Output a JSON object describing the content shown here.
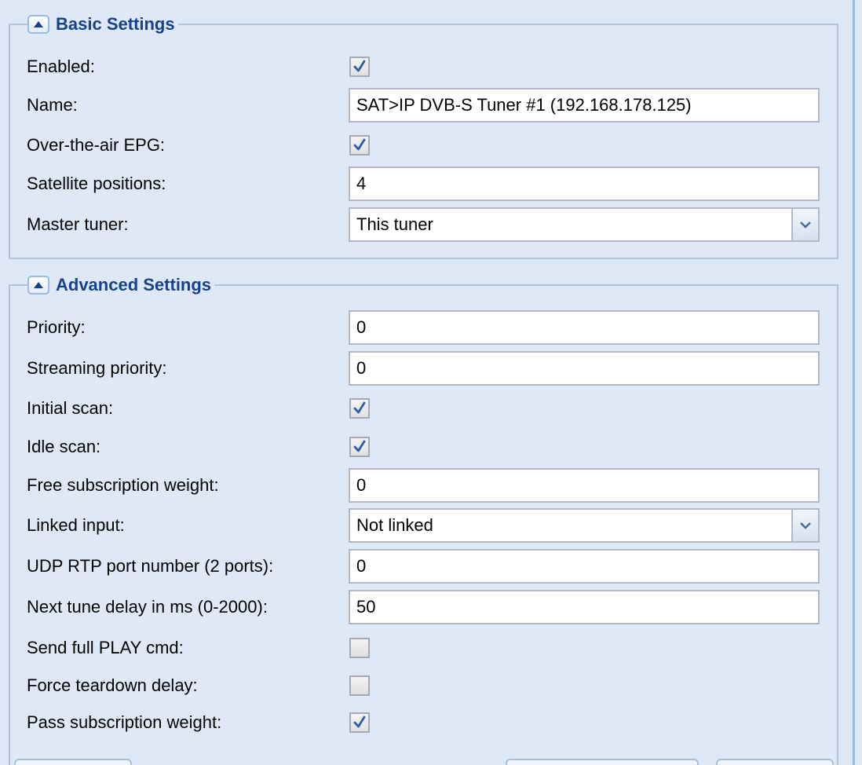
{
  "basic_settings": {
    "title": "Basic Settings",
    "fields": {
      "enabled": {
        "label": "Enabled:",
        "checked": true
      },
      "name": {
        "label": "Name:",
        "value": "SAT>IP DVB-S Tuner #1 (192.168.178.125)"
      },
      "ota_epg": {
        "label": "Over-the-air EPG:",
        "checked": true
      },
      "satellite_positions": {
        "label": "Satellite positions:",
        "value": "4"
      },
      "master_tuner": {
        "label": "Master tuner:",
        "value": "This tuner"
      }
    }
  },
  "advanced_settings": {
    "title": "Advanced Settings",
    "fields": {
      "priority": {
        "label": "Priority:",
        "value": "0"
      },
      "streaming_priority": {
        "label": "Streaming priority:",
        "value": "0"
      },
      "initial_scan": {
        "label": "Initial scan:",
        "checked": true
      },
      "idle_scan": {
        "label": "Idle scan:",
        "checked": true
      },
      "free_subscription_weight": {
        "label": "Free subscription weight:",
        "value": "0"
      },
      "linked_input": {
        "label": "Linked input:",
        "value": "Not linked"
      },
      "udp_rtp_port": {
        "label": "UDP RTP port number (2 ports):",
        "value": "0"
      },
      "next_tune_delay": {
        "label": "Next tune delay in ms (0-2000):",
        "value": "50"
      },
      "send_full_play": {
        "label": "Send full PLAY cmd:",
        "checked": false
      },
      "force_teardown_delay": {
        "label": "Force teardown delay:",
        "checked": false
      },
      "pass_subscription_weight": {
        "label": "Pass subscription weight:",
        "checked": true
      }
    }
  },
  "colors": {
    "panel_background": "#dfe8f6",
    "legend_title": "#15428b",
    "fieldset_border": "#b5c3d6",
    "input_border": "#b5b8c8",
    "check_mark": "#2b5aa6"
  },
  "icons": {
    "collapse": "triangle-up-icon",
    "combo_trigger": "chevron-down-icon",
    "checkbox_mark": "check-icon"
  }
}
